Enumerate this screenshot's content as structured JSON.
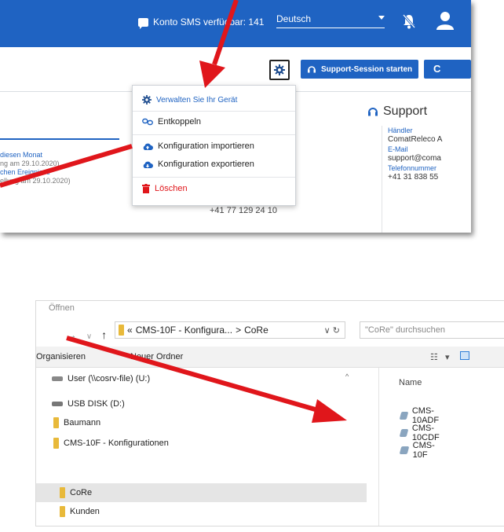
{
  "topbar": {
    "sms_label": "Konto SMS verfügbar: 141",
    "language": "Deutsch"
  },
  "actions": {
    "support_session": "Support-Session starten",
    "refresh_label": "C"
  },
  "menu": {
    "items": [
      {
        "label": "Verwalten Sie Ihr Gerät",
        "icon": "gear-icon"
      },
      {
        "label": "Entkoppeln",
        "icon": "unlink-icon"
      },
      {
        "label": "Konfiguration importieren",
        "icon": "cloud-upload-icon"
      },
      {
        "label": "Konfiguration exportieren",
        "icon": "cloud-download-icon"
      },
      {
        "label": "Löschen",
        "icon": "trash-icon"
      }
    ]
  },
  "left_links": {
    "l1": "diesen Monat",
    "l2": "ng am 29.10.2020)",
    "l3": "chen Ereignisse",
    "l4": "ellung am 29.10.2020)"
  },
  "phone": "+41 77 129 24 10",
  "support": {
    "title": "Support",
    "dealer_label": "Händler",
    "dealer": "ComatReleco A",
    "email_label": "E-Mail",
    "email": "support@coma",
    "phone_label": "Telefonnummer",
    "phone": "+41 31 838 55"
  },
  "dialog": {
    "title": "Öffnen",
    "breadcrumb_prefix": "«",
    "breadcrumb_1": "CMS-10F - Konfigura...",
    "breadcrumb_sep": ">",
    "breadcrumb_2": "CoRe",
    "search_placeholder": "\"CoRe\" durchsuchen",
    "organize": "Organisieren",
    "new_folder": "Neuer Ordner",
    "tree": [
      {
        "label": "User (\\\\cosrv-file) (U:)",
        "icon": "network-drive-icon"
      },
      {
        "label": "USB DISK (D:)",
        "icon": "usb-drive-icon"
      },
      {
        "label": "Baumann",
        "icon": "folder-icon"
      },
      {
        "label": "CMS-10F - Konfigurationen",
        "icon": "folder-icon"
      },
      {
        "label": "CoRe",
        "icon": "folder-icon"
      },
      {
        "label": "Kunden",
        "icon": "folder-icon"
      }
    ],
    "column_name": "Name",
    "files": [
      "CMS-10ADF",
      "CMS-10CDF",
      "CMS-10F"
    ]
  },
  "colors": {
    "brand_blue": "#1f63c2",
    "arrow_red": "#e0161b",
    "delete_red": "#e0161b",
    "folder_yellow": "#e8b93a"
  }
}
